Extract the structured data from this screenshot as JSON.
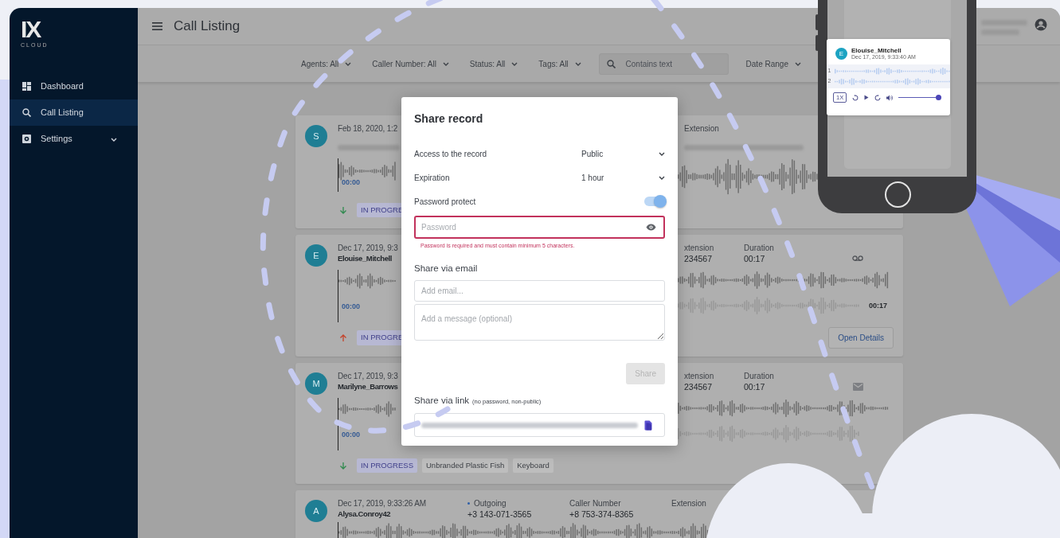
{
  "sidebar": {
    "logo": {
      "text": "IX",
      "subtext": "CLOUD"
    },
    "items": [
      {
        "label": "Dashboard",
        "selected": false
      },
      {
        "label": "Call Listing",
        "selected": true
      },
      {
        "label": "Settings",
        "selected": false,
        "expanded": false
      }
    ]
  },
  "header": {
    "title": "Call Listing"
  },
  "filters": [
    {
      "kind": "dropdown",
      "label": "Agents: All"
    },
    {
      "kind": "dropdown",
      "label": "Caller Number: All"
    },
    {
      "kind": "dropdown",
      "label": "Status: All"
    },
    {
      "kind": "dropdown",
      "label": "Tags: All"
    },
    {
      "kind": "search",
      "placeholder": "Contains text"
    },
    {
      "kind": "dropdown",
      "label": "Date Range"
    }
  ],
  "calls": [
    {
      "kind": "partial",
      "avatar": "S",
      "date": "Feb 18, 2020, 1:2",
      "name_blurred": true,
      "fields": [
        {
          "label": "Extension",
          "value_blurred": true
        }
      ],
      "start_time": "00:00",
      "outgoing": false,
      "tags": [
        {
          "label": "IN PROGRE",
          "kind": "status"
        }
      ]
    },
    {
      "kind": "partial",
      "avatar": "E",
      "date": "Dec 17, 2019, 9:3",
      "name": "Elouise_Mitchell",
      "fields": [
        {
          "label": "xtension",
          "value": "234567"
        },
        {
          "label": "Duration",
          "value": "00:17"
        }
      ],
      "start_time": "00:00",
      "end_time": "00:17",
      "outgoing": true,
      "tags": [
        {
          "label": "IN PROGRE",
          "kind": "status"
        }
      ],
      "button": "Open Details"
    },
    {
      "kind": "partial",
      "avatar": "M",
      "date": "Dec 17, 2019, 9:3",
      "name": "Marilyne_Barrows",
      "fields": [
        {
          "label": "xtension",
          "value": "234567"
        },
        {
          "label": "Duration",
          "value": "00:17"
        }
      ],
      "start_time": "00:00",
      "outgoing": false,
      "tags": [
        {
          "label": "IN PROGRESS",
          "kind": "status"
        },
        {
          "label": "Unbranded Plastic Fish",
          "kind": "tag"
        },
        {
          "label": "Keyboard",
          "kind": "tag"
        }
      ]
    },
    {
      "kind": "full",
      "avatar": "A",
      "date": "Dec 17, 2019, 9:33:26 AM",
      "name": "Alysa.Conroy42",
      "fields": [
        {
          "label": "Outgoing",
          "value": "+3 143-071-3565",
          "kind": "direction"
        },
        {
          "label": "Caller Number",
          "value": "+8 753-374-8365"
        },
        {
          "label": "Extension"
        }
      ]
    }
  ],
  "dialog": {
    "title": "Share record",
    "selects": [
      {
        "label": "Access to the record",
        "value": "Public"
      },
      {
        "label": "Expiration",
        "value": "1 hour"
      }
    ],
    "password_protect": {
      "label": "Password protect",
      "on": true
    },
    "password": {
      "placeholder": "Password",
      "invalid": true,
      "error": "Password is required and must contain minimum 5 characters."
    },
    "email_heading": "Share via email",
    "email": {
      "placeholder": "Add email..."
    },
    "message": {
      "placeholder": "Add a message (optional)"
    },
    "share_button": {
      "label": "Share",
      "disabled": true
    },
    "link_heading": "Share via link",
    "link_note": "(no password, non-public)"
  },
  "phone_player": {
    "avatar": "E",
    "name": "Elouise_Mitchell",
    "date": "Dec 17, 2019, 9:33:40 AM",
    "channels": [
      "1",
      "2"
    ],
    "speed": "1X",
    "volume": {
      "level": 1
    }
  }
}
